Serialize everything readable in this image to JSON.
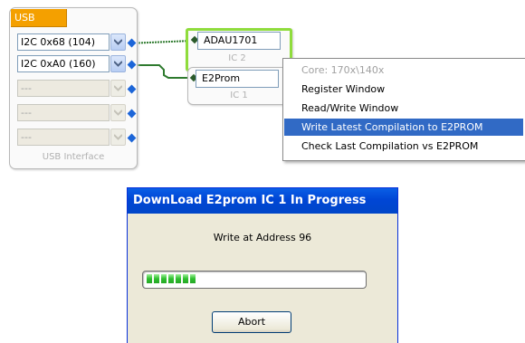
{
  "usb_interface": {
    "title": "USB",
    "caption": "USB Interface",
    "ports": [
      {
        "label": "I2C 0x68 (104)",
        "enabled": true
      },
      {
        "label": "I2C 0xA0 (160)",
        "enabled": true
      },
      {
        "label": "---",
        "enabled": false
      },
      {
        "label": "---",
        "enabled": false
      },
      {
        "label": "---",
        "enabled": false
      }
    ]
  },
  "ic_blocks": [
    {
      "label": "ADAU1701",
      "caption": "IC 2",
      "selected": true
    },
    {
      "label": "E2Prom",
      "caption": "IC 1",
      "selected": false
    }
  ],
  "context_menu": {
    "items": [
      {
        "label": "Core: 170x\\140x",
        "disabled": true
      },
      {
        "label": "Register Window"
      },
      {
        "label": "Read/Write Window"
      },
      {
        "label": "Write Latest Compilation to E2PROM",
        "selected": true
      },
      {
        "label": "Check Last Compilation vs E2PROM"
      }
    ]
  },
  "dialog": {
    "title": "DownLoad E2prom IC 1 In Progress",
    "status": "Write at Address 96",
    "progress_fraction": 0.25,
    "abort_label": "Abort"
  },
  "colors": {
    "usb_title_bg": "#f4a000",
    "selection_green": "#8fdc3c",
    "menu_highlight": "#316ac5",
    "pin_blue": "#1d66d8",
    "wire_green": "#2e7a2e"
  }
}
